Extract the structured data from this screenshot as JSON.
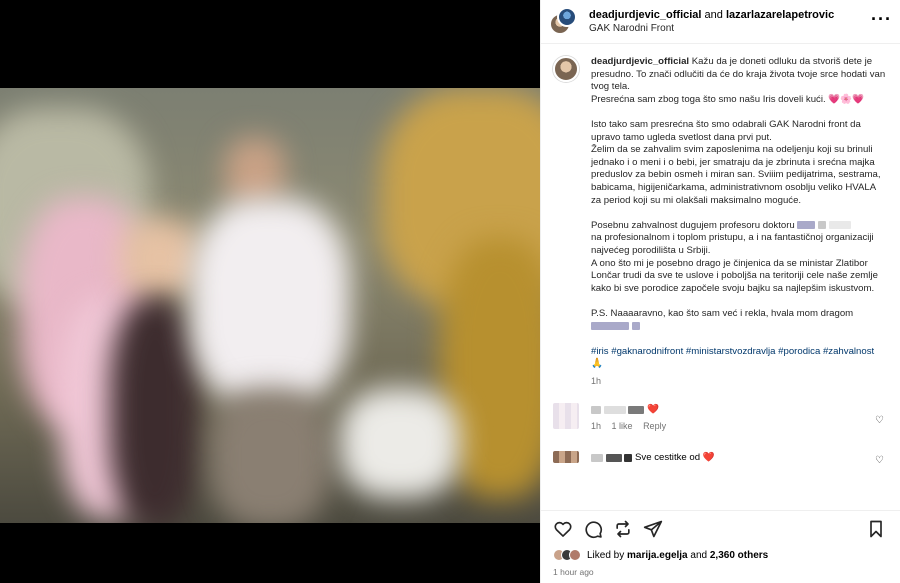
{
  "header": {
    "user1": "deadjurdjevic_official",
    "and": "and",
    "user2": "lazarlazarelapetrovic",
    "location": "GAK Narodni Front"
  },
  "caption": {
    "username": "deadjurdjevic_official",
    "p1": "Kažu da je doneti odluku da stvoriš dete je presudno. To znači odlučiti da će do kraja života tvoje srce hodati van tvog tela.",
    "p1b": "Presrećna sam zbog toga što smo našu Iris doveli kući. 💗🌸💗",
    "p2": "Isto tako sam presrećna što smo odabrali GAK Narodni front da upravo tamo ugleda svetlost dana prvi put.",
    "p2b": "Želim da se zahvalim svim zaposlenima na odeljenju koji su brinuli jednako i o meni i o bebi, jer smatraju da je zbrinuta i srećna majka preduslov za bebin osmeh i miran san. Sviiim pedijatrima, sestrama, babicama, higijeničarkama, administrativnom osoblju veliko HVALA za period koji su mi olakšali maksimalno moguće.",
    "p3a": "Posebnu zahvalnost dugujem profesoru doktoru",
    "p3b": "na profesionalnom i toplom pristupu, a i na fantastičnoj organizaciji najvećeg porodilišta u Srbiji.",
    "p3c": "A ono što mi je posebno drago je činjenica da se ministar Zlatibor Lončar trudi da sve te uslove i poboljša na teritoriji cele naše zemlje kako bi sve porodice započele svoju bajku sa najlepšim iskustvom.",
    "p4": "P.S. Naaaaravno, kao što sam već i rekla, hvala mom dragom",
    "hashtags": "#iris #gaknarodnifront #ministarstvozdravlja #porodica #zahvalnost 🙏",
    "time": "1h"
  },
  "comments": [
    {
      "emoji": "❤️",
      "time": "1h",
      "likes": "1 like",
      "reply": "Reply"
    },
    {
      "text": "Sve cestitke od",
      "emoji": "❤️"
    }
  ],
  "footer": {
    "liked_by": "Liked by",
    "liker": "marija.egelja",
    "and": "and",
    "others": "2,360 others",
    "ago": "1 hour ago"
  }
}
